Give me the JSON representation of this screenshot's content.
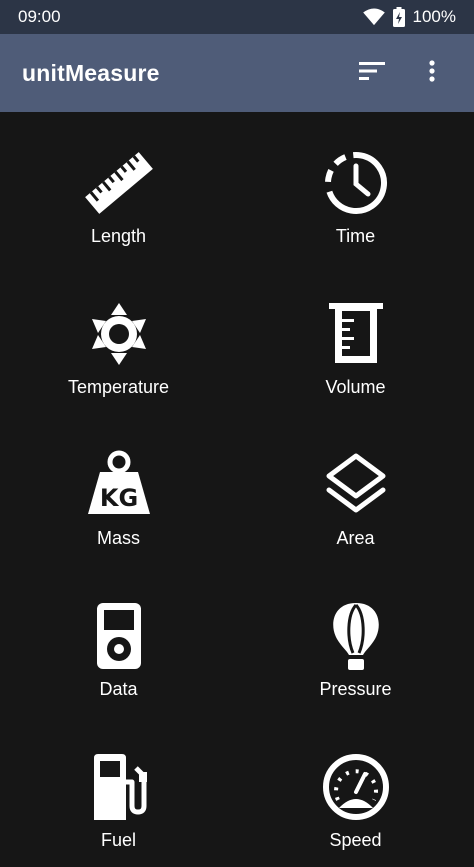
{
  "status": {
    "time": "09:00",
    "battery": "100%",
    "icons": [
      "wifi-icon",
      "battery-charging-icon"
    ]
  },
  "appbar": {
    "title": "unitMeasure",
    "actions": [
      "sort-icon",
      "more-vert-icon"
    ]
  },
  "categories": [
    {
      "label": "Length",
      "icon": "ruler-icon"
    },
    {
      "label": "Time",
      "icon": "clock-icon"
    },
    {
      "label": "Temperature",
      "icon": "sun-icon"
    },
    {
      "label": "Volume",
      "icon": "beaker-icon"
    },
    {
      "label": "Mass",
      "icon": "kg-weight-icon"
    },
    {
      "label": "Area",
      "icon": "layers-icon"
    },
    {
      "label": "Data",
      "icon": "music-player-icon"
    },
    {
      "label": "Pressure",
      "icon": "hot-air-balloon-icon"
    },
    {
      "label": "Fuel",
      "icon": "fuel-pump-icon"
    },
    {
      "label": "Speed",
      "icon": "speedometer-icon"
    }
  ],
  "colors": {
    "statusbar": "#2c3546",
    "appbar": "#4f5c78",
    "background": "#161616",
    "foreground": "#ffffff"
  }
}
